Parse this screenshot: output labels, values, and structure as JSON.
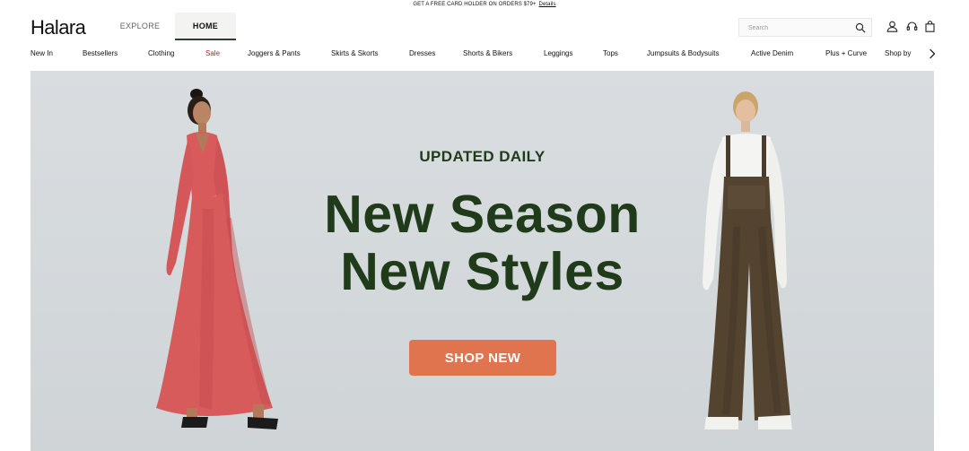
{
  "promo": {
    "text": "GET A FREE CARD HOLDER ON ORDERS $79+",
    "link": "Details"
  },
  "header": {
    "logo": "Halara",
    "tabs": [
      {
        "label": "EXPLORE"
      },
      {
        "label": "HOME",
        "active": true
      }
    ],
    "search_placeholder": "Search",
    "icons": [
      "search-icon",
      "account-icon",
      "support-icon",
      "bag-icon"
    ]
  },
  "nav": {
    "items": [
      {
        "label": "New In"
      },
      {
        "label": "Bestsellers"
      },
      {
        "label": "Clothing"
      },
      {
        "label": "Sale",
        "highlight": true
      },
      {
        "label": "Joggers & Pants"
      },
      {
        "label": "Skirts & Skorts"
      },
      {
        "label": "Dresses"
      },
      {
        "label": "Shorts & Bikers"
      },
      {
        "label": "Leggings"
      },
      {
        "label": "Tops"
      },
      {
        "label": "Jumpsuits & Bodysuits"
      },
      {
        "label": "Active Denim"
      },
      {
        "label": "Plus + Curve"
      },
      {
        "label": "Shop by"
      }
    ]
  },
  "hero": {
    "eyebrow": "UPDATED DAILY",
    "title_line1": "New Season",
    "title_line2": "New Styles",
    "cta": "SHOP NEW"
  },
  "colors": {
    "sale": "#c0172d",
    "hero_text": "#1f3b1a",
    "cta": "#e0744e",
    "hero_bg": "#d6dadd"
  }
}
